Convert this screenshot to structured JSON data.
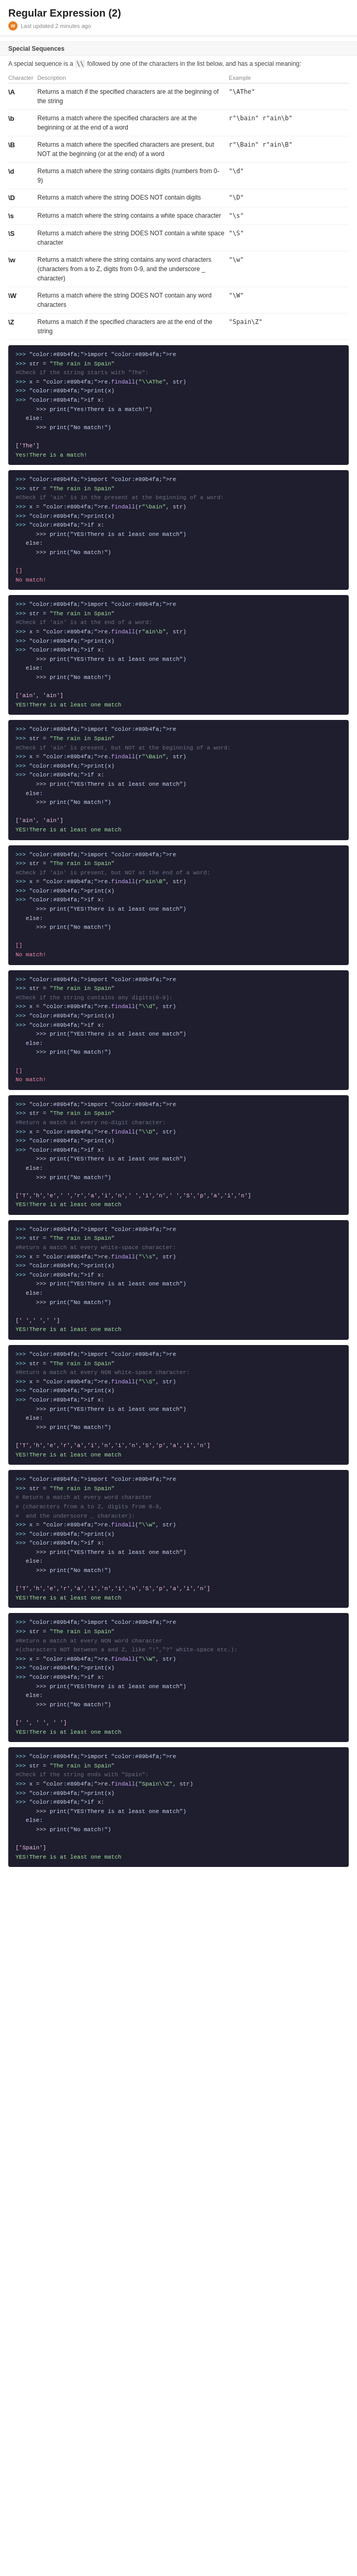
{
  "header": {
    "title": "Regular Expression (2)",
    "meta": "Last updated 2 minutes ago"
  },
  "section_label": "Special Sequences",
  "intro": "A special sequence is a   followed by one of the characters in the list below, and has a special meaning:",
  "table": {
    "columns": [
      "Character",
      "Description",
      "Example"
    ],
    "rows": [
      {
        "char": "\\A",
        "desc": "Returns a match if the specified characters are at the beginning of the string",
        "example": "\"\\AThe\""
      },
      {
        "char": "\\b",
        "desc": "Returns a match where the specified characters are at the beginning or at the end of a word",
        "example": "r\"\\bain\"\nr\"ain\\b\""
      },
      {
        "char": "\\B",
        "desc": "Returns a match where the specified characters are present, but NOT at the beginning (or at the end) of a word",
        "example": "r\"\\Bain\"\nr\"ain\\B\""
      },
      {
        "char": "\\d",
        "desc": "Returns a match where the string contains digits (numbers from 0-9)",
        "example": "\"\\d\""
      },
      {
        "char": "\\D",
        "desc": "Returns a match where the string DOES NOT contain digits",
        "example": "\"\\D\""
      },
      {
        "char": "\\s",
        "desc": "Returns a match where the string contains a white space character",
        "example": "\"\\s\""
      },
      {
        "char": "\\S",
        "desc": "Returns a match where the string DOES NOT contain a white space character",
        "example": "\"\\S\""
      },
      {
        "char": "\\w",
        "desc": "Returns a match where the string contains any word characters (characters from a to Z, digits from 0-9, and the underscore _ character)",
        "example": "\"\\w\""
      },
      {
        "char": "\\W",
        "desc": "Returns a match where the string DOES NOT contain any word characters",
        "example": "\"\\W\""
      },
      {
        "char": "\\Z",
        "desc": "Returns a match if the specified characters are at the end of the string",
        "example": "\"Spain\\Z\""
      }
    ]
  },
  "code_blocks": [
    {
      "id": "block1",
      "comment": "#Check if the string starts with \"The\":",
      "lines": [
        ">>> import re",
        ">>> str = \"The rain in Spain\"",
        "#Check if the string starts with \"The\":",
        ">>> x = re.findall(\"\\\\AThe\", str)",
        ">>> print(x)",
        ">>> if x:",
        "      >>> print(\"Yes!There is a match!\")",
        "   else:",
        "      >>> print(\"No match!\")",
        "",
        "['The']",
        "Yes!There is a match!"
      ]
    },
    {
      "id": "block2",
      "comment": "#Check if 'ain' is in the present at the beginning of a word:",
      "lines": [
        ">>> import re",
        ">>> str = \"The rain in Spain\"",
        "#Check if 'ain' is in the present at the beginning of a word:",
        ">>> x = re.findall(r\"\\bain\", str)",
        ">>> print(x)",
        ">>> if x:",
        "      >>> print(\"YES!There is at least one match\")",
        "   else:",
        "      >>> print(\"No match!\")",
        "",
        "[]",
        "No match!"
      ]
    },
    {
      "id": "block3",
      "comment": "#Check if 'ain' is at the end of a word:",
      "lines": [
        ">>> import re",
        ">>> str = \"The rain in Spain\"",
        "#Check if 'ain' is at the end of a word:",
        ">>> x = re.findall(r\"ain\\b\", str)",
        ">>> print(x)",
        ">>> if x:",
        "      >>> print(\"YES!There is at least one match\")",
        "   else:",
        "      >>> print(\"No match!\")",
        "",
        "['ain', 'ain']",
        "YES!There is at least one match"
      ]
    },
    {
      "id": "block4",
      "comment": "#Check if 'ain' is present, but NOT at the beginning of a word:",
      "lines": [
        ">>> import re",
        ">>> str = \"The rain in Spain\"",
        "#Check if 'ain' is present, but NOT at the beginning of a word:",
        ">>> x = re.findall(r\"\\Bain\", str)",
        ">>> print(x)",
        ">>> if x:",
        "      >>> print(\"YES!There is at least one match\")",
        "   else:",
        "      >>> print(\"No match!\")",
        "",
        "['ain', 'ain']",
        "YES!There is at least one match"
      ]
    },
    {
      "id": "block5",
      "comment": "#Check if 'ain' is present, but NOT at the end of a word:",
      "lines": [
        ">>> import re",
        ">>> str = \"The rain in Spain\"",
        "#Check if 'ain' is present, but NOT at the end of a word:",
        ">>> x = re.findall(r\"ain\\B\", str)",
        ">>> print(x)",
        ">>> if x:",
        "      >>> print(\"YES!There is at least one match\")",
        "   else:",
        "      >>> print(\"No match!\")",
        "",
        "[]",
        "No match!"
      ]
    },
    {
      "id": "block6",
      "comment": "#Check if the string contains any digits(0-9):",
      "lines": [
        ">>> import re",
        ">>> str = \"The rain in Spain\"",
        "#Check if the string contains any digits(0-9):",
        ">>> x = re.findall(\"\\\\d\", str)",
        ">>> print(x)",
        ">>> if x:",
        "      >>> print(\"YES!There is at least one match\")",
        "   else:",
        "      >>> print(\"No match!\")",
        "",
        "[]",
        "No match!"
      ]
    },
    {
      "id": "block7",
      "comment": "#Return a match at every no-digit character:",
      "lines": [
        ">>> import re",
        ">>> str = \"The rain in Spain\"",
        "#Return a match at every no-digit character:",
        ">>> x = re.findall(\"\\\\D\", str)",
        ">>> print(x)",
        ">>> if x:",
        "      >>> print(\"YES!There is at least one match\")",
        "   else:",
        "      >>> print(\"No match!\")",
        "",
        "['T','h','e',' ','r','a','i','n',' ','i','n',' ','S','p','a','i','n']",
        "YES!There is at least one match"
      ]
    },
    {
      "id": "block8",
      "comment": "#Return a match at every white-space character:",
      "lines": [
        ">>> import re",
        ">>> str = \"The rain in Spain\"",
        "#Return a match at every white-space character:",
        ">>> x = re.findall(\"\\\\s\", str)",
        ">>> print(x)",
        ">>> if x:",
        "      >>> print(\"YES!There is at least one match\")",
        "   else:",
        "      >>> print(\"No match!\")",
        "",
        "[' ',' ',' ']",
        "YES!There is at least one match"
      ]
    },
    {
      "id": "block9",
      "comment": "#Return a match at every NON white-space character:",
      "lines": [
        ">>> import re",
        ">>> str = \"The rain in Spain\"",
        "#Return a match at every NON white-space character:",
        ">>> x = re.findall(\"\\\\S\", str)",
        ">>> print(x)",
        ">>> if x:",
        "      >>> print(\"YES!There is at least one match\")",
        "   else:",
        "      >>> print(\"No match!\")",
        "",
        "['T','h','e','r','a','i','n','i','n','S','p','a','i','n']",
        "YES!There is at least one match"
      ]
    },
    {
      "id": "block10",
      "comment": "#Return a match at every word character:",
      "lines": [
        ">>> import re",
        ">>> str = \"The rain in Spain\"",
        "# Return a match at every word character",
        "# (characters from a to Z, digits from 0-9,",
        "#  and the underscore _ character):",
        ">>> x = re.findall(\"\\\\w\", str)",
        ">>> print(x)",
        ">>> if x:",
        "      >>> print(\"YES!There is at least one match\")",
        "   else:",
        "      >>> print(\"No match!\")",
        "",
        "['T','h','e','r','a','i','n','i','n','S','p','a','i','n']",
        "YES!There is at least one match"
      ]
    },
    {
      "id": "block11",
      "comment": "#Return a match at every NON word character:",
      "lines": [
        ">>> import re",
        ">>> str = \"The rain in Spain\"",
        "#Return a match at every NON word character",
        "#(characters NOT between a and Z, like \"!\",\"?\" white-space etc.):",
        ">>> x = re.findall(\"\\\\W\", str)",
        ">>> print(x)",
        ">>> if x:",
        "      >>> print(\"YES!There is at least one match\")",
        "   else:",
        "      >>> print(\"No match!\")",
        "",
        "[' ', ' ', ' ']",
        "YES!There is at least one match"
      ]
    },
    {
      "id": "block12",
      "comment": "#Check if the string ends with \"Spain\":",
      "lines": [
        ">>> import re",
        ">>> str = \"The rain in Spain\"",
        "#Check if the string ends with \"Spain\":",
        ">>> x = re.findall(\"Spain\\\\Z\", str)",
        ">>> print(x)",
        ">>> if x:",
        "      >>> print(\"YES!There is at least one match\")",
        "   else:",
        "      >>> print(\"No match!\")",
        "",
        "['Spain']",
        "YES!There is at least one match"
      ]
    }
  ]
}
